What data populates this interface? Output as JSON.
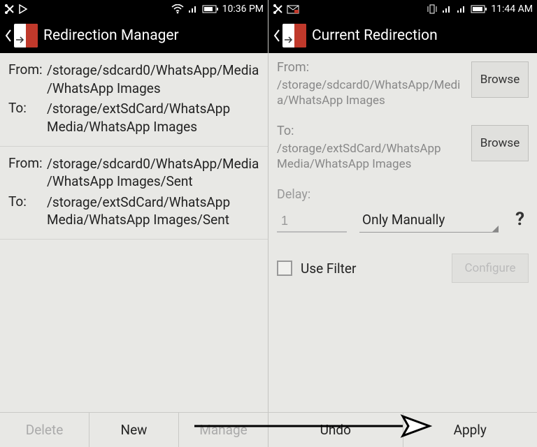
{
  "left": {
    "statusbar": {
      "time": "10:36 PM"
    },
    "title": "Redirection Manager",
    "entries": [
      {
        "from_label": "From:",
        "from": "/storage/sdcard0/WhatsApp/Media/WhatsApp Images",
        "to_label": "To:",
        "to": "/storage/extSdCard/WhatsApp Media/WhatsApp Images"
      },
      {
        "from_label": "From:",
        "from": "/storage/sdcard0/WhatsApp/Media/WhatsApp Images/Sent",
        "to_label": "To:",
        "to": "/storage/extSdCard/WhatsApp Media/WhatsApp Images/Sent"
      }
    ],
    "buttons": {
      "delete": "Delete",
      "new": "New",
      "manage": "Manage"
    }
  },
  "right": {
    "statusbar": {
      "time": "11:44 AM"
    },
    "title": "Current Redirection",
    "from_label": "From:",
    "from_path": "/storage/sdcard0/WhatsApp/Media/WhatsApp Images",
    "to_label": "To:",
    "to_path": "/storage/extSdCard/WhatsApp Media/WhatsApp Images",
    "browse": "Browse",
    "delay_label": "Delay:",
    "delay_value": "1",
    "delay_mode": "Only Manually",
    "help": "?",
    "use_filter": "Use Filter",
    "configure": "Configure",
    "buttons": {
      "undo": "Undo",
      "apply": "Apply"
    }
  }
}
